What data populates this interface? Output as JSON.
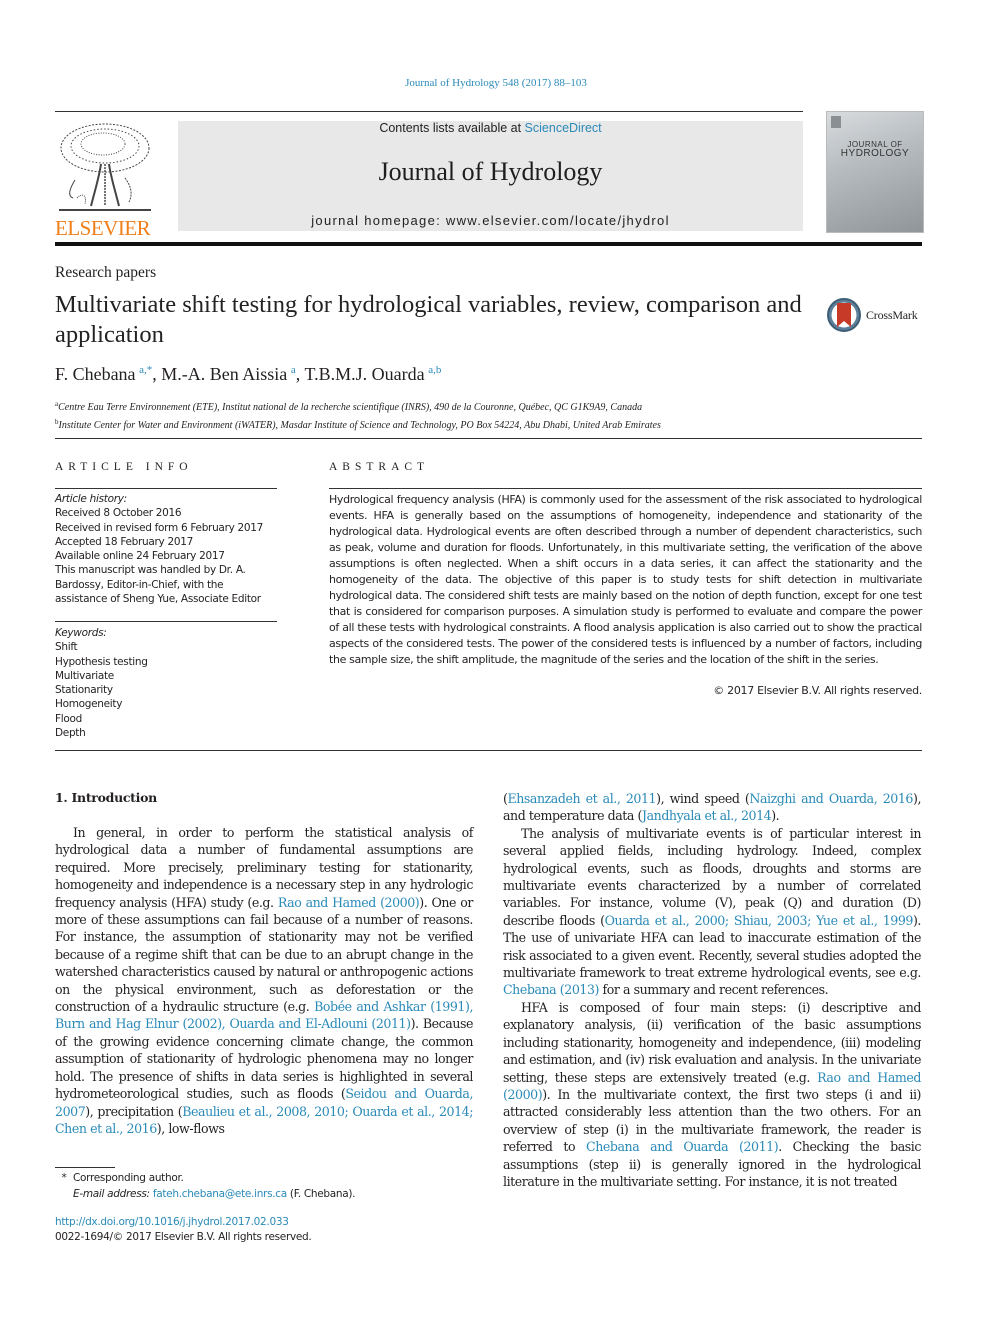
{
  "journal_ref": "Journal of Hydrology 548 (2017) 88–103",
  "header": {
    "contents_prefix": "Contents lists available at ",
    "contents_link": "ScienceDirect",
    "journal_name": "Journal of Hydrology",
    "homepage": "journal homepage: www.elsevier.com/locate/jhydrol",
    "publisher_logo_text": "ELSEVIER",
    "cover_title_line1": "JOURNAL OF",
    "cover_title_line2": "HYDROLOGY",
    "colors": {
      "elsevier_orange": "#f07f1a",
      "link_blue": "#2a8ab8",
      "header_bg": "#e8e8e8"
    }
  },
  "article": {
    "section_type": "Research papers",
    "title": "Multivariate shift testing for hydrological variables, review, comparison and application",
    "crossmark_label": "CrossMark",
    "authors": [
      {
        "name": "F. Chebana",
        "sup": "a,*"
      },
      {
        "name": "M.-A. Ben Aissia",
        "sup": "a"
      },
      {
        "name": "T.B.M.J. Ouarda",
        "sup": "a,b"
      }
    ],
    "affiliations": [
      {
        "mark": "a",
        "text": "Centre Eau Terre Environnement (ETE), Institut national de la recherche scientifique (INRS), 490 de la Couronne, Québec, QC G1K9A9, Canada"
      },
      {
        "mark": "b",
        "text": "Institute Center for Water and Environment (iWATER), Masdar Institute of Science and Technology, PO Box 54224, Abu Dhabi, United Arab Emirates"
      }
    ]
  },
  "article_info": {
    "heading": "ARTICLE INFO",
    "history_label": "Article history:",
    "history": [
      "Received 8 October 2016",
      "Received in revised form 6 February 2017",
      "Accepted 18 February 2017",
      "Available online 24 February 2017",
      "This manuscript was handled by Dr. A. Bardossy, Editor-in-Chief, with the assistance of Sheng Yue, Associate Editor"
    ],
    "keywords_label": "Keywords:",
    "keywords": [
      "Shift",
      "Hypothesis testing",
      "Multivariate",
      "Stationarity",
      "Homogeneity",
      "Flood",
      "Depth"
    ]
  },
  "abstract": {
    "heading": "ABSTRACT",
    "text": "Hydrological frequency analysis (HFA) is commonly used for the assessment of the risk associated to hydrological events. HFA is generally based on the assumptions of homogeneity, independence and stationarity of the hydrological data. Hydrological events are often described through a number of dependent characteristics, such as peak, volume and duration for floods. Unfortunately, in this multivariate setting, the verification of the above assumptions is often neglected. When a shift occurs in a data series, it can affect the stationarity and the homogeneity of the data. The objective of this paper is to study tests for shift detection in multivariate hydrological data. The considered shift tests are mainly based on the notion of depth function, except for one test that is considered for comparison purposes. A simulation study is performed to evaluate and compare the power of all these tests with hydrological constraints. A flood analysis application is also carried out to show the practical aspects of the considered tests. The power of the considered tests is influenced by a number of factors, including the sample size, the shift amplitude, the magnitude of the series and the location of the shift in the series.",
    "copyright": "© 2017 Elsevier B.V. All rights reserved."
  },
  "body": {
    "intro_heading": "1. Introduction",
    "col1": {
      "p1_a": "In general, in order to perform the statistical analysis of hydrological data a number of fundamental assumptions are required. More precisely, preliminary testing for stationarity, homogeneity and independence is a necessary step in any hydrologic frequency analysis (HFA) study (e.g. ",
      "ref1": "Rao and Hamed (2000)",
      "p1_b": "). One or more of these assumptions can fail because of a number of reasons. For instance, the assumption of stationarity may not be verified because of a regime shift that can be due to an abrupt change in the watershed characteristics caused by natural or anthropogenic actions on the physical environment, such as deforestation or the construction of a hydraulic structure (e.g. ",
      "ref2": "Bobée and Ashkar (1991), Burn and Hag Elnur (2002), Ouarda and El-Adlouni (2011)",
      "p1_c": "). Because of the growing evidence concerning climate change, the common assumption of stationarity of hydrologic phenomena may no longer hold. The presence of shifts in data series is highlighted in several hydrometeorological studies, such as floods (",
      "ref3": "Seidou and Ouarda, 2007",
      "p1_d": "), precipitation (",
      "ref4": "Beaulieu et al., 2008, 2010; Ouarda et al., 2014; Chen et al., 2016",
      "p1_e": "), low-flows"
    },
    "col2": {
      "p1_a": "(",
      "ref5": "Ehsanzadeh et al., 2011",
      "p1_b": "), wind speed (",
      "ref6": "Naizghi and Ouarda, 2016",
      "p1_c": "), and temperature data (",
      "ref7": "Jandhyala et al., 2014",
      "p1_d": ").",
      "p2_a": "The analysis of multivariate events is of particular interest in several applied fields, including hydrology. Indeed, complex hydrological events, such as floods, droughts and storms are multivariate events characterized by a number of correlated variables. For instance, volume (V), peak (Q) and duration (D) describe floods (",
      "ref8": "Ouarda et al., 2000; Shiau, 2003; Yue et al., 1999",
      "p2_b": "). The use of univariate HFA can lead to inaccurate estimation of the risk associated to a given event. Recently, several studies adopted the multivariate framework to treat extreme hydrological events, see e.g. ",
      "ref9": "Chebana (2013)",
      "p2_c": " for a summary and recent references.",
      "p3_a": "HFA is composed of four main steps: (i) descriptive and explanatory analysis, (ii) verification of the basic assumptions including stationarity, homogeneity and independence, (iii) modeling and estimation, and (iv) risk evaluation and analysis. In the univariate setting, these steps are extensively treated (e.g. ",
      "ref10": "Rao and Hamed (2000)",
      "p3_b": "). In the multivariate context, the first two steps (i and ii) attracted considerably less attention than the two others. For an overview of step (i) in the multivariate framework, the reader is referred to ",
      "ref11": "Chebana and Ouarda (2011)",
      "p3_c": ". Checking the basic assumptions (step ii) is generally ignored in the hydrological literature in the multivariate setting. For instance, it is not treated"
    }
  },
  "footnote": {
    "mark": "*",
    "corresponding": "Corresponding author.",
    "email_label": "E-mail address: ",
    "email": "fateh.chebana@ete.inrs.ca",
    "email_suffix": " (F. Chebana)."
  },
  "doi": {
    "url": "http://dx.doi.org/10.1016/j.jhydrol.2017.02.033",
    "issn_line": "0022-1694/© 2017 Elsevier B.V. All rights reserved."
  }
}
